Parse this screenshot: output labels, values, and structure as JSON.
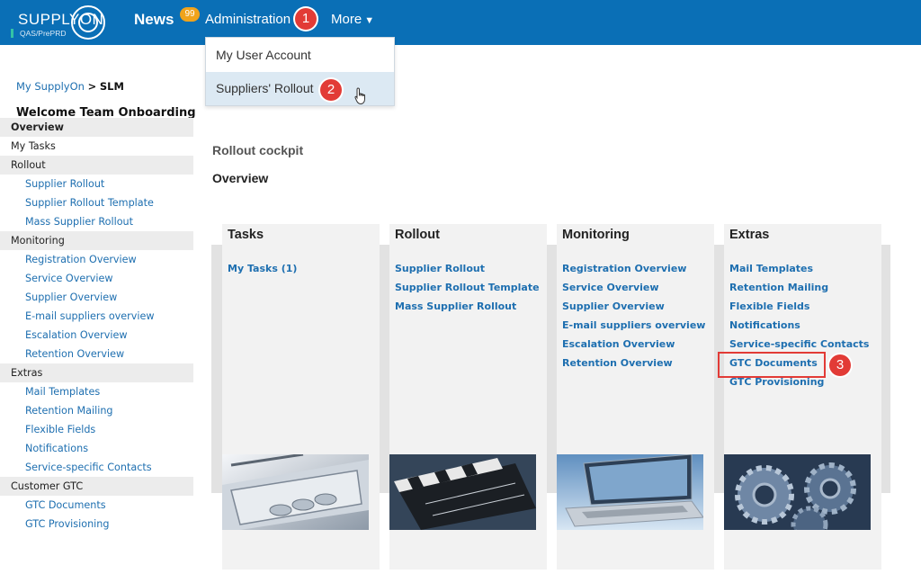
{
  "header": {
    "logo_text": "SUPPLYON",
    "logo_subtext": "QAS/PrePRD",
    "nav": {
      "news": "News",
      "news_badge": "99",
      "administration": "Administration",
      "more": "More",
      "more_caret": "▼"
    }
  },
  "steps": {
    "s1": "1",
    "s2": "2",
    "s3": "3"
  },
  "dropdown": {
    "items": [
      "My User Account",
      "Suppliers' Rollout"
    ]
  },
  "breadcrumb": {
    "root": "My SupplyOn",
    "sep": ">",
    "current": "SLM"
  },
  "welcome": "Welcome Team Onboarding",
  "sidebar": {
    "overview": "Overview",
    "my_tasks": "My Tasks",
    "rollout": {
      "label": "Rollout",
      "items": [
        "Supplier Rollout",
        "Supplier Rollout Template",
        "Mass Supplier Rollout"
      ]
    },
    "monitoring": {
      "label": "Monitoring",
      "items": [
        "Registration Overview",
        "Service Overview",
        "Supplier Overview",
        "E-mail suppliers overview",
        "Escalation Overview",
        "Retention Overview"
      ]
    },
    "extras": {
      "label": "Extras",
      "items": [
        "Mail Templates",
        "Retention Mailing",
        "Flexible Fields",
        "Notifications",
        "Service-specific Contacts"
      ]
    },
    "customer_gtc": {
      "label": "Customer GTC",
      "items": [
        "GTC Documents",
        "GTC Provisioning"
      ]
    }
  },
  "main": {
    "cockpit_title": "Rollout cockpit",
    "overview_title": "Overview",
    "columns": [
      {
        "title": "Tasks",
        "links": [
          "My Tasks (1)"
        ]
      },
      {
        "title": "Rollout",
        "links": [
          "Supplier Rollout",
          "Supplier Rollout Template",
          "Mass Supplier Rollout"
        ]
      },
      {
        "title": "Monitoring",
        "links": [
          "Registration Overview",
          "Service Overview",
          "Supplier Overview",
          "E-mail suppliers overview",
          "Escalation Overview",
          "Retention Overview"
        ]
      },
      {
        "title": "Extras",
        "links": [
          "Mail Templates",
          "Retention Mailing",
          "Flexible Fields",
          "Notifications",
          "Service-specific Contacts",
          "GTC Documents",
          "GTC Provisioning"
        ]
      }
    ]
  },
  "colors": {
    "topbar": "#0a6fb6",
    "link": "#1e6fb0",
    "badge": "#f0a31b",
    "step": "#e23b36"
  }
}
